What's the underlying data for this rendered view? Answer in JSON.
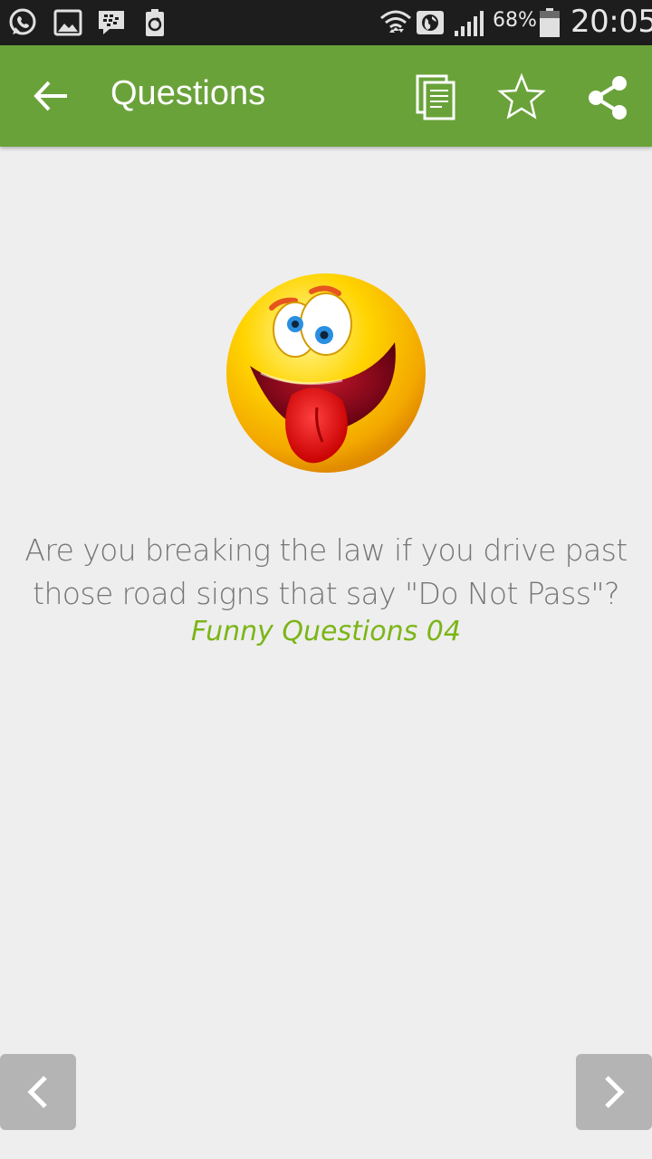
{
  "status_bar": {
    "battery_percent": "68%",
    "time": "20:05",
    "icons": [
      "whatsapp-icon",
      "gallery-icon",
      "bbm-icon",
      "battery-saver-icon",
      "wifi-icon",
      "globe-icon",
      "signal-icon",
      "battery-icon"
    ]
  },
  "app_bar": {
    "title": "Questions",
    "color": "#6aa23a",
    "actions": [
      "copy-icon",
      "star-icon",
      "share-icon"
    ]
  },
  "content": {
    "emoji": "crazy-tongue-emoji",
    "question": "Are you breaking the law if you drive past those road signs that say \"Do Not Pass\"?",
    "category": "Funny Questions 04",
    "category_color": "#7cb518"
  },
  "navigation": {
    "prev": "chevron-left-icon",
    "next": "chevron-right-icon"
  }
}
